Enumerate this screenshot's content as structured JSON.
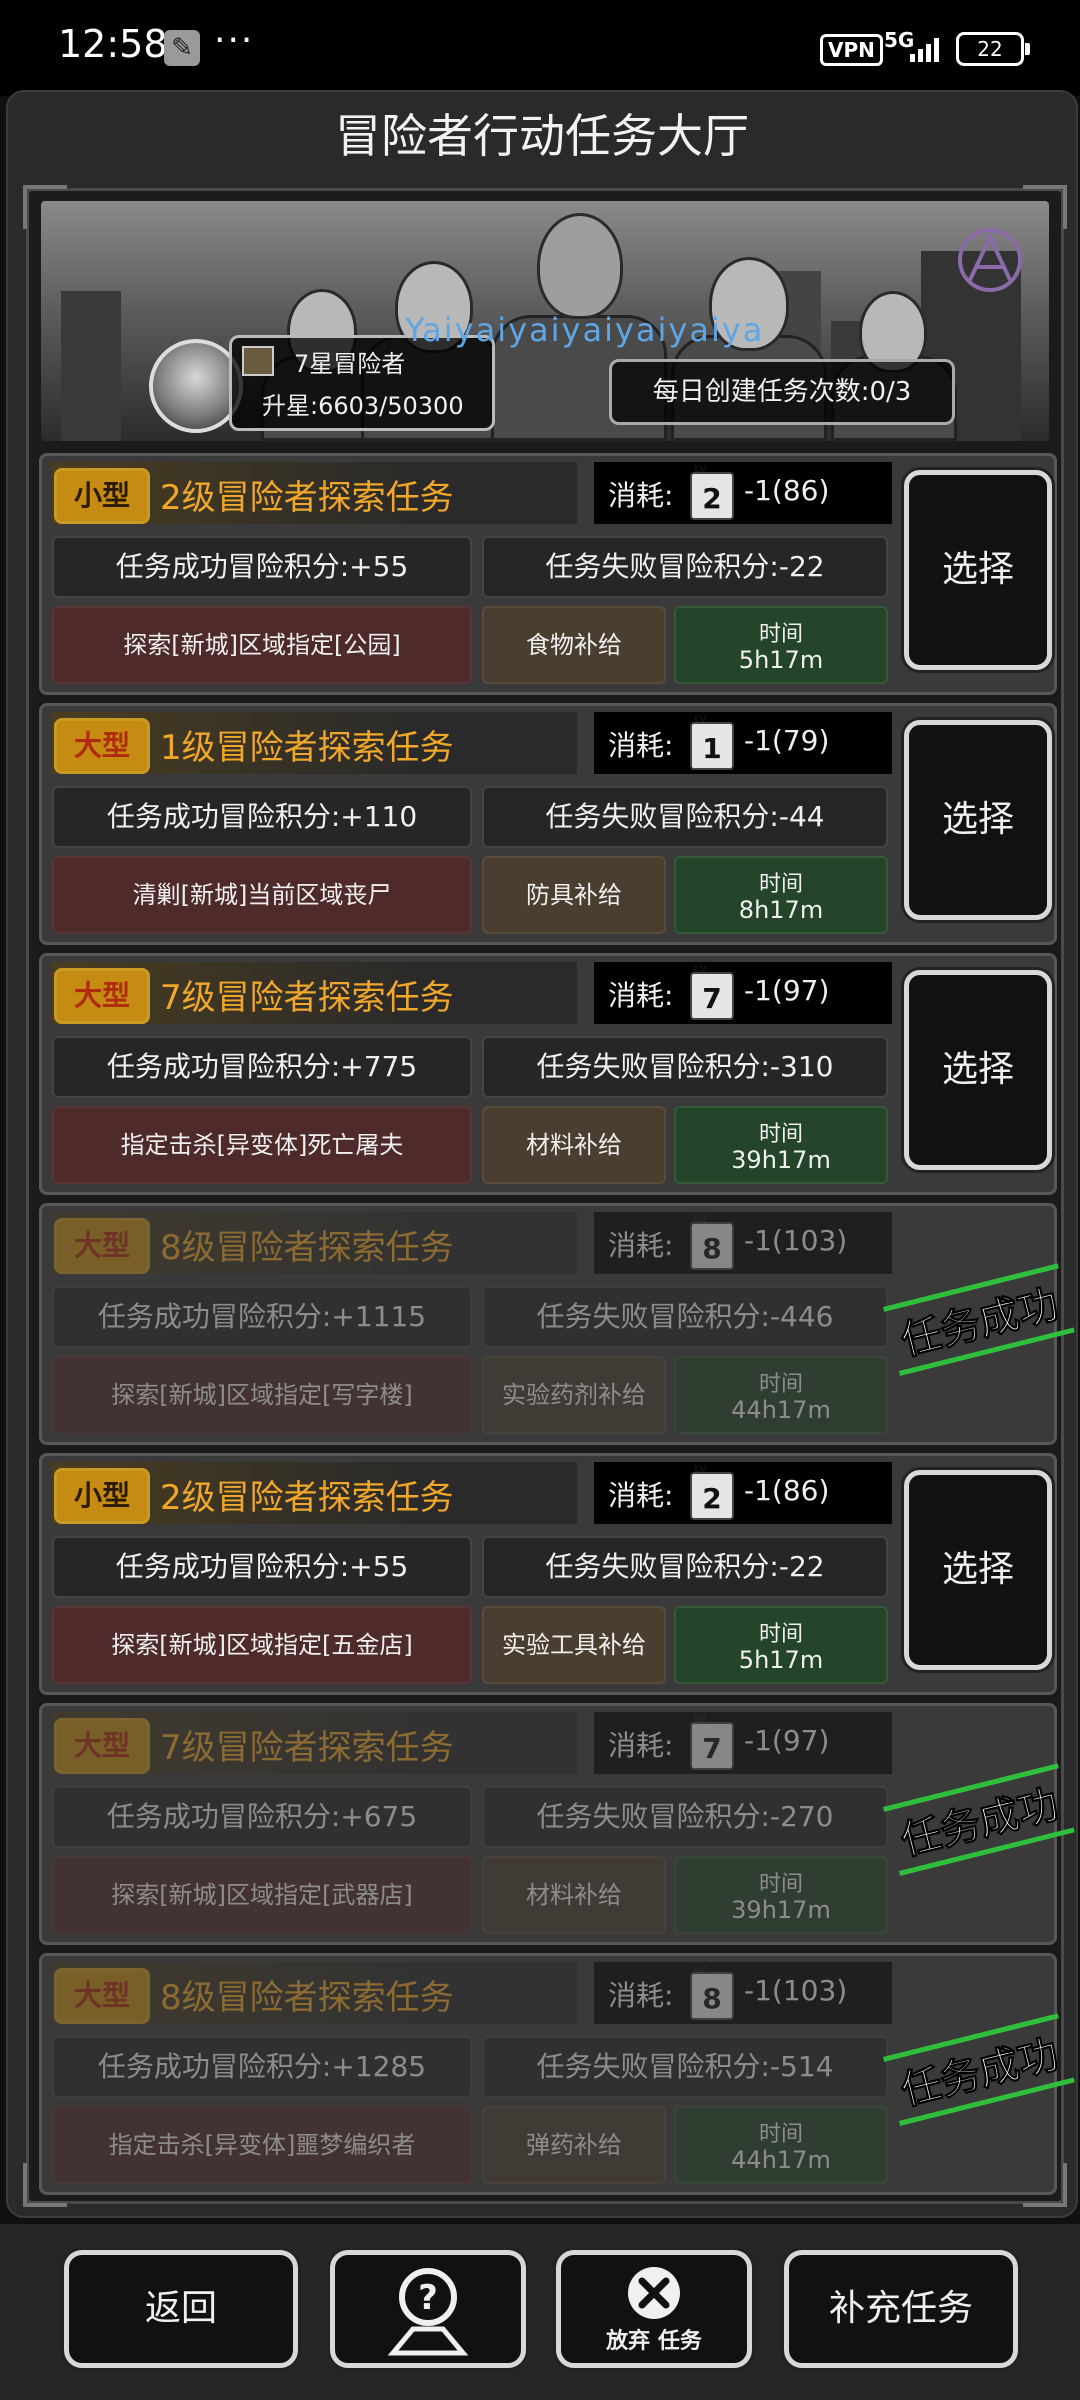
{
  "status_bar": {
    "time": "12:58",
    "dots": "···",
    "vpn": "VPN",
    "network": "5G",
    "battery": "22",
    "icons": [
      "wrench-icon",
      "signal-icon",
      "battery-icon"
    ]
  },
  "title": "冒险者行动任务大厅",
  "profile": {
    "rank": "7星冒险者",
    "progress": "升星:6603/50300",
    "player_name": "Yaiyaiyaiyaiyaiyaiya",
    "daily": "每日创建任务次数:0/3"
  },
  "tasks": [
    {
      "badge": "小型",
      "name": "2级冒险者探索任务",
      "cost_label": "消耗:",
      "card_level": "2",
      "cost": "-1(86)",
      "success": "任务成功冒险积分:+55",
      "fail": "任务失败冒险积分:-22",
      "target": "探索[新城]区域指定[公园]",
      "supply": "食物补给",
      "time_label": "时间",
      "time": "5h17m",
      "action": "选择"
    },
    {
      "badge": "大型",
      "name": "1级冒险者探索任务",
      "cost_label": "消耗:",
      "card_level": "1",
      "cost": "-1(79)",
      "success": "任务成功冒险积分:+110",
      "fail": "任务失败冒险积分:-44",
      "target": "清剿[新城]当前区域丧尸",
      "supply": "防具补给",
      "time_label": "时间",
      "time": "8h17m",
      "action": "选择"
    },
    {
      "badge": "大型",
      "name": "7级冒险者探索任务",
      "cost_label": "消耗:",
      "card_level": "7",
      "cost": "-1(97)",
      "success": "任务成功冒险积分:+775",
      "fail": "任务失败冒险积分:-310",
      "target": "指定击杀[异变体]死亡屠夫",
      "supply": "材料补给",
      "time_label": "时间",
      "time": "39h17m",
      "action": "选择"
    },
    {
      "badge": "大型",
      "name": "8级冒险者探索任务",
      "cost_label": "消耗:",
      "card_level": "8",
      "cost": "-1(103)",
      "success": "任务成功冒险积分:+1115",
      "fail": "任务失败冒险积分:-446",
      "target": "探索[新城]区域指定[写字楼]",
      "supply": "实验药剂补给",
      "time_label": "时间",
      "time": "44h17m",
      "stamp": "任务成功"
    },
    {
      "badge": "小型",
      "name": "2级冒险者探索任务",
      "cost_label": "消耗:",
      "card_level": "2",
      "cost": "-1(86)",
      "success": "任务成功冒险积分:+55",
      "fail": "任务失败冒险积分:-22",
      "target": "探索[新城]区域指定[五金店]",
      "supply": "实验工具补给",
      "time_label": "时间",
      "time": "5h17m",
      "action": "选择"
    },
    {
      "badge": "大型",
      "name": "7级冒险者探索任务",
      "cost_label": "消耗:",
      "card_level": "7",
      "cost": "-1(97)",
      "success": "任务成功冒险积分:+675",
      "fail": "任务失败冒险积分:-270",
      "target": "探索[新城]区域指定[武器店]",
      "supply": "材料补给",
      "time_label": "时间",
      "time": "39h17m",
      "stamp": "任务成功"
    },
    {
      "badge": "大型",
      "name": "8级冒险者探索任务",
      "cost_label": "消耗:",
      "card_level": "8",
      "cost": "-1(103)",
      "success": "任务成功冒险积分:+1285",
      "fail": "任务失败冒险积分:-514",
      "target": "指定击杀[异变体]噩梦编织者",
      "supply": "弹药补给",
      "time_label": "时间",
      "time": "44h17m",
      "stamp": "任务成功"
    }
  ],
  "bottom": {
    "back": "返回",
    "help_icon": "help-icon",
    "abandon": "放弃 任务",
    "abandon_icon": "close-icon",
    "refill": "补充任务"
  }
}
